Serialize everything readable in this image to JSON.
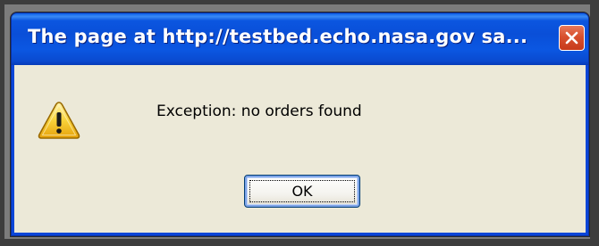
{
  "dialog": {
    "title": "The page at http://testbed.echo.nasa.gov sa...",
    "message": "Exception: no orders found",
    "ok_label": "OK",
    "icon": "warning-icon",
    "close_icon": "close-icon"
  },
  "colors": {
    "titlebar": "#0a4fd8",
    "client_background": "#ece9d8",
    "close_button": "#d8502e",
    "warning_yellow": "#f8d23a"
  }
}
